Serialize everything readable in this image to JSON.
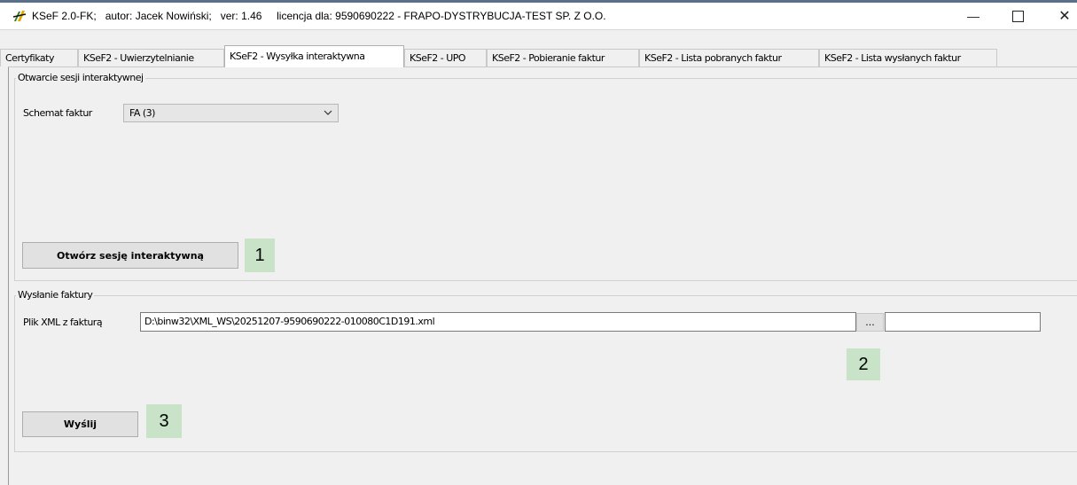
{
  "window": {
    "title": "KSeF 2.0-FK;   autor: Jacek Nowiński;   ver: 1.46     licencja dla: 9590690222 - FRAPO-DYSTRYBUCJA-TEST SP. Z O.O.",
    "minimize_label": "—",
    "close_label": "✕"
  },
  "tabs": [
    {
      "label": "Certyfikaty"
    },
    {
      "label": "KSeF2 - Uwierzytelnianie"
    },
    {
      "label": "KSeF2 - Wysyłka interaktywna"
    },
    {
      "label": "KSeF2 - UPO"
    },
    {
      "label": "KSeF2 - Pobieranie faktur"
    },
    {
      "label": "KSeF2 - Lista pobranych faktur"
    },
    {
      "label": "KSeF2 - Lista wysłanych faktur"
    }
  ],
  "session_group": {
    "legend": "Otwarcie sesji interaktywnej",
    "schema_label": "Schemat faktur",
    "schema_value": "FA (3)",
    "open_button": "Otwórz sesję interaktywną",
    "step_badge": "1"
  },
  "send_group": {
    "legend": "Wysłanie faktury",
    "file_label": "Plik XML z fakturą",
    "file_value": "D:\\binw32\\XML_WS\\20251207-9590690222-010080C1D191.xml",
    "browse_button": "...",
    "step_badge_browse": "2",
    "send_button": "Wyślij",
    "step_badge_send": "3"
  }
}
